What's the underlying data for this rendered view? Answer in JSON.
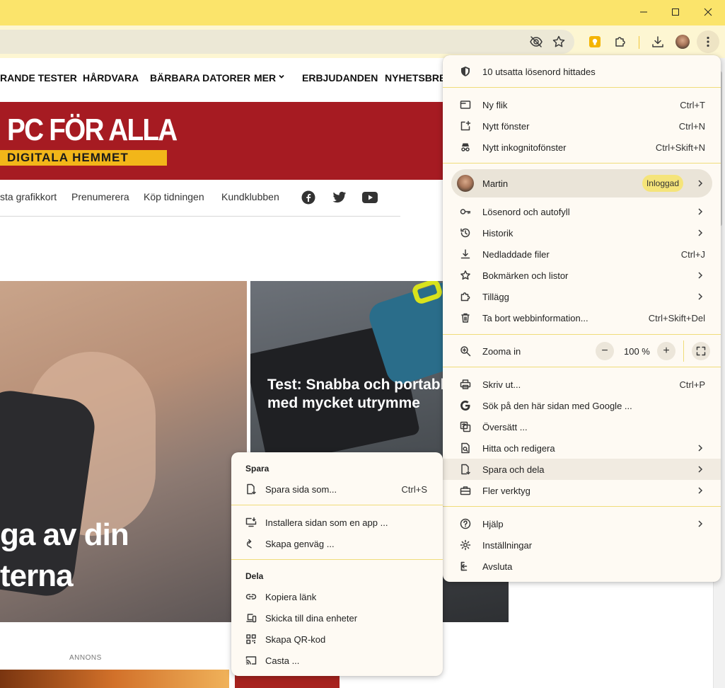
{
  "site": {
    "topnav": [
      "RANDE TESTER",
      "HÅRDVARA",
      "BÄRBARA DATORER",
      "MER",
      "ERBJUDANDEN",
      "NYHETSBREV"
    ],
    "logo_main": "PC FÖR ALLA",
    "logo_sub": "DIGITALA HEMMET",
    "subnav": [
      "sta grafikkort",
      "Prenumerera",
      "Köp tidningen",
      "Kundklubben"
    ],
    "hero_left_title_1": "ga av din",
    "hero_left_title_2": "terna",
    "hero_right_title": "Test: Snabba och portabla ssd:er med mycket utrymme",
    "annons": "ANNONS"
  },
  "menu": {
    "password_alert": "10 utsatta lösenord hittades",
    "new_tab": "Ny flik",
    "new_tab_sc": "Ctrl+T",
    "new_window": "Nytt fönster",
    "new_window_sc": "Ctrl+N",
    "incognito": "Nytt inkognitofönster",
    "incognito_sc": "Ctrl+Skift+N",
    "profile_name": "Martin",
    "profile_badge": "Inloggad",
    "passwords": "Lösenord och autofyll",
    "history": "Historik",
    "downloads": "Nedladdade filer",
    "downloads_sc": "Ctrl+J",
    "bookmarks": "Bokmärken och listor",
    "extensions": "Tillägg",
    "clear_data": "Ta bort webbinformation...",
    "clear_data_sc": "Ctrl+Skift+Del",
    "zoom_label": "Zooma in",
    "zoom_minus": "−",
    "zoom_value": "100 %",
    "zoom_plus": "+",
    "print": "Skriv ut...",
    "print_sc": "Ctrl+P",
    "search_google": "Sök på den här sidan med Google ...",
    "translate": "Översätt ...",
    "find_edit": "Hitta och redigera",
    "save_share": "Spara och dela",
    "more_tools": "Fler verktyg",
    "help": "Hjälp",
    "settings": "Inställningar",
    "exit": "Avsluta"
  },
  "submenu": {
    "save_header": "Spara",
    "save_page": "Spara sida som...",
    "save_page_sc": "Ctrl+S",
    "install_app": "Installera sidan som en app ...",
    "create_shortcut": "Skapa genväg ...",
    "share_header": "Dela",
    "copy_link": "Kopiera länk",
    "send_devices": "Skicka till dina enheter",
    "qr_code": "Skapa QR-kod",
    "cast": "Casta ..."
  },
  "colors": {
    "titlebar": "#fbe46b",
    "menu_bg": "#fefaf3",
    "banner": "#a61b22",
    "badge": "#f5e47a"
  }
}
